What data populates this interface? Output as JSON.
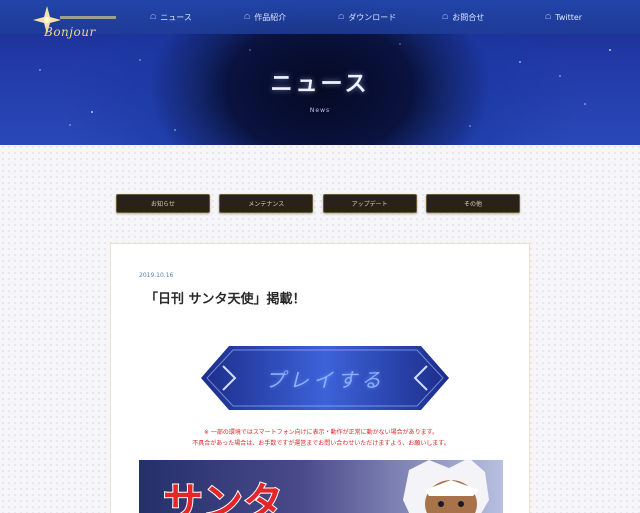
{
  "header": {
    "logo": {
      "text": "Bonjour"
    },
    "nav": [
      {
        "label": "ニュース"
      },
      {
        "label": "作品紹介"
      },
      {
        "label": "ダウンロード"
      },
      {
        "label": "お問合せ"
      },
      {
        "label": "Twitter"
      }
    ],
    "title": "ニュース",
    "subtitle": "News"
  },
  "filters": [
    {
      "label": "お知らせ"
    },
    {
      "label": "メンテナンス"
    },
    {
      "label": "アップデート"
    },
    {
      "label": "その他"
    }
  ],
  "article": {
    "date": "2019.10.16",
    "title": "「日刊 サンタ天使」掲載！",
    "banner_text": "プレイする",
    "notice_lines": [
      "※ 一部の環境ではスマートフォン向けに表示・動作が正常に動かない場合があります。",
      "不具合があった場合は、お手数ですが運営までお問い合わせいただけますよう、お願いします。"
    ],
    "image_text": "サンタ"
  },
  "colors": {
    "accent_red": "#d8282b",
    "filter_bg": "#2a2218",
    "header_blue": "#2a48b8"
  }
}
